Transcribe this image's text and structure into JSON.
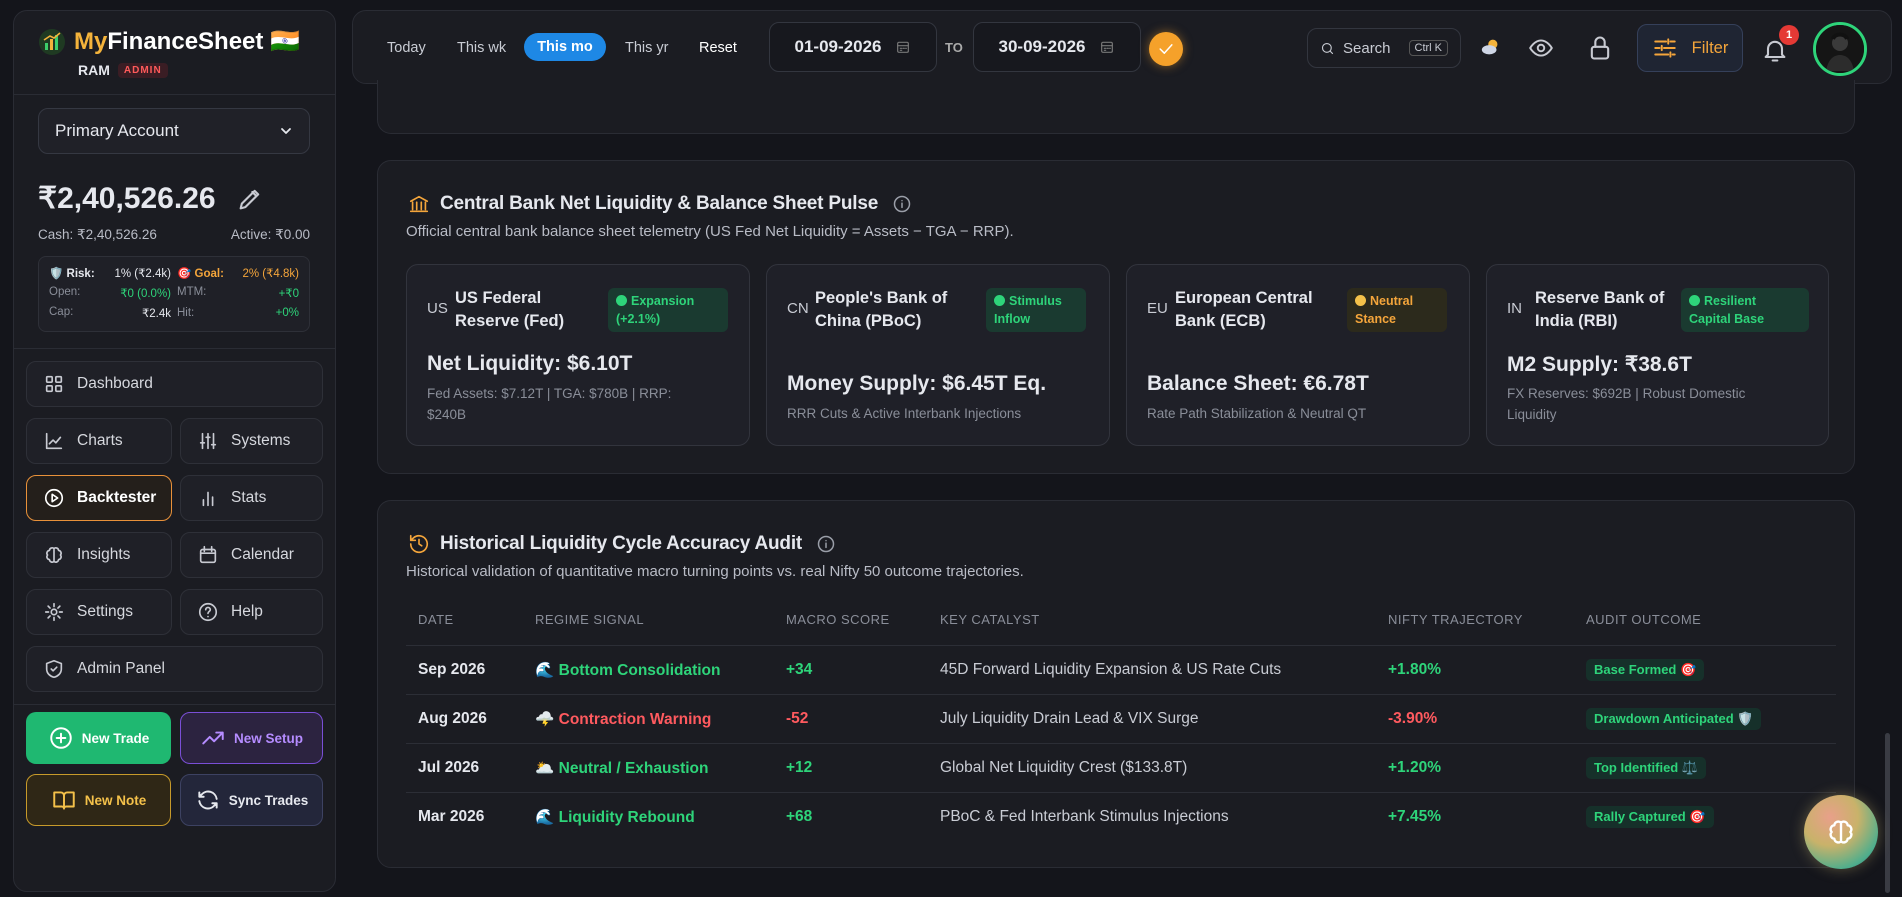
{
  "brand": {
    "name_part1": "My",
    "name_part2": "FinanceSheet",
    "flag": "🇮🇳"
  },
  "user": {
    "name": "RAM",
    "role": "ADMIN"
  },
  "account": {
    "selected": "Primary Account",
    "balance": "₹2,40,526.26",
    "cash": "Cash: ₹2,40,526.26",
    "active": "Active: ₹0.00"
  },
  "risk": {
    "risk_label": "Risk:",
    "risk_value": "1% (₹2.4k)",
    "goal_label": "Goal:",
    "goal_value": "2% (₹4.8k)",
    "open_label": "Open:",
    "open_value": "₹0 (0.0%)",
    "mtm_label": "MTM:",
    "mtm_value": "+₹0",
    "cap_label": "Cap:",
    "cap_value": "₹2.4k",
    "hit_label": "Hit:",
    "hit_value": "+0%"
  },
  "nav": {
    "dashboard": "Dashboard",
    "charts": "Charts",
    "systems": "Systems",
    "backtester": "Backtester",
    "stats": "Stats",
    "insights": "Insights",
    "calendar": "Calendar",
    "settings": "Settings",
    "help": "Help",
    "admin": "Admin Panel"
  },
  "actions": {
    "new_trade": "New Trade",
    "new_setup": "New Setup",
    "new_note": "New Note",
    "sync": "Sync Trades"
  },
  "topbar": {
    "today": "Today",
    "this_wk": "This wk",
    "this_mo": "This mo",
    "this_yr": "This yr",
    "reset": "Reset",
    "from_date": "01-09-2026",
    "to_label": "TO",
    "to_date": "30-09-2026",
    "search": "Search",
    "shortcut": "Ctrl K",
    "filter": "Filter",
    "notif_count": "1"
  },
  "liquidity": {
    "title": "Central Bank Net Liquidity & Balance Sheet Pulse",
    "subtitle": "Official central bank balance sheet telemetry (US Fed Net Liquidity = Assets − TGA − RRP).",
    "cards": [
      {
        "code": "US",
        "name": "US Federal Reserve (Fed)",
        "tag_line1": "Expansion",
        "tag_line2": "(+2.1%)",
        "metric": "Net Liquidity: $6.10T",
        "detail_line1": "Fed Assets: $7.12T | TGA: $780B | RRP:",
        "detail_line2": "$240B"
      },
      {
        "code": "CN",
        "name": "People's Bank of China (PBoC)",
        "tag_line1": "Stimulus",
        "tag_line2": "Inflow",
        "metric": "Money Supply: $6.45T Eq.",
        "detail_line1": "RRR Cuts & Active Interbank Injections",
        "detail_line2": ""
      },
      {
        "code": "EU",
        "name": "European Central Bank (ECB)",
        "tag_line1": "Neutral",
        "tag_line2": "Stance",
        "metric": "Balance Sheet: €6.78T",
        "detail_line1": "Rate Path Stabilization & Neutral QT",
        "detail_line2": ""
      },
      {
        "code": "IN",
        "name": "Reserve Bank of India (RBI)",
        "tag_line1": "Resilient",
        "tag_line2": "Capital Base",
        "metric": "M2 Supply: ₹38.6T",
        "detail_line1": "FX Reserves: $692B | Robust Domestic",
        "detail_line2": "Liquidity"
      }
    ]
  },
  "audit": {
    "title": "Historical Liquidity Cycle Accuracy Audit",
    "subtitle": "Historical validation of quantitative macro turning points vs. real Nifty 50 outcome trajectories.",
    "headers": [
      "DATE",
      "REGIME SIGNAL",
      "MACRO SCORE",
      "KEY CATALYST",
      "NIFTY TRAJECTORY",
      "AUDIT OUTCOME"
    ],
    "rows": [
      {
        "date": "Sep 2026",
        "signal": "Bottom Consolidation",
        "score": "+34",
        "catalyst": "45D Forward Liquidity Expansion & US Rate Cuts",
        "nifty": "+1.80%",
        "outcome": "Base Formed 🎯"
      },
      {
        "date": "Aug 2026",
        "signal": "Contraction Warning",
        "score": "-52",
        "catalyst": "July Liquidity Drain Lead & VIX Surge",
        "nifty": "-3.90%",
        "outcome": "Drawdown Anticipated 🛡️"
      },
      {
        "date": "Jul 2026",
        "signal": "Neutral / Exhaustion",
        "score": "+12",
        "catalyst": "Global Net Liquidity Crest ($133.8T)",
        "nifty": "+1.20%",
        "outcome": "Top Identified ⚖️"
      },
      {
        "date": "Mar 2026",
        "signal": "Liquidity Rebound",
        "score": "+68",
        "catalyst": "PBoC & Fed Interbank Stimulus Injections",
        "nifty": "+7.45%",
        "outcome": "Rally Captured 🎯"
      }
    ]
  },
  "colors": {
    "accent": "#f4a53b",
    "positive": "#2ed47a",
    "negative": "#ff5a5f",
    "active_pill": "#1e88e5"
  }
}
